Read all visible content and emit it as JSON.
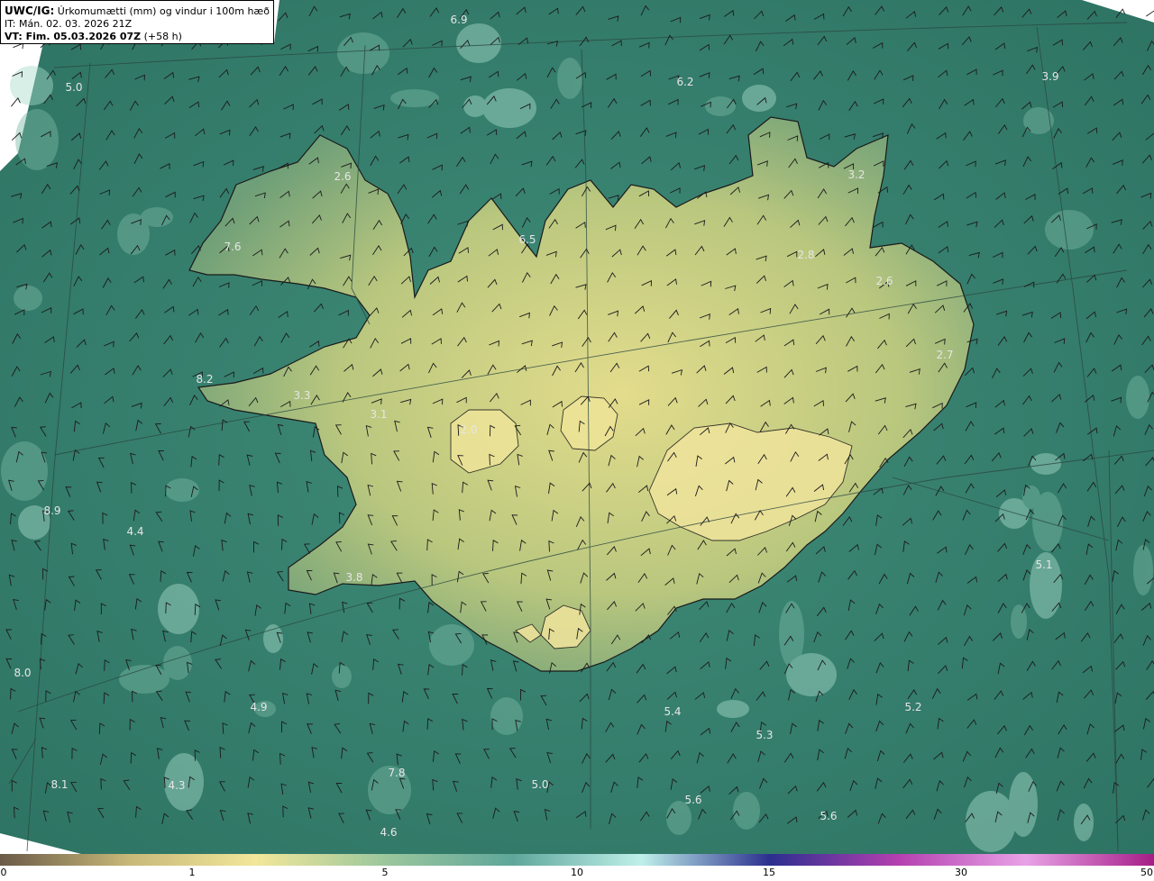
{
  "header": {
    "model": "UWC/IG:",
    "title": "Úrkomumætti (mm) og vindur i 100m hæð",
    "init_time": "IT: Mán. 02. 03. 2026 21Z",
    "valid_label": "VT: Fim. 05.03.2026 07Z",
    "lead": "(+58 h)"
  },
  "colorbar": {
    "ticks": [
      "0",
      "1",
      "5",
      "10",
      "15",
      "30",
      "50"
    ],
    "stops": [
      "#6b5a48",
      "#c7b878",
      "#f2e79a",
      "#9cc79d",
      "#5fa69a",
      "#bff0ea",
      "#2b2f8f",
      "#b43fb0",
      "#e8a2e6",
      "#a51d87"
    ]
  },
  "map_values": [
    {
      "v": "6.9"
    },
    {
      "v": "5.0"
    },
    {
      "v": "6.2"
    },
    {
      "v": "3.9"
    },
    {
      "v": "3.2"
    },
    {
      "v": "2.6"
    },
    {
      "v": "6.5"
    },
    {
      "v": "2.8"
    },
    {
      "v": "7.6"
    },
    {
      "v": "2.6"
    },
    {
      "v": "2.7"
    },
    {
      "v": "8.2"
    },
    {
      "v": "3.3"
    },
    {
      "v": "3.1"
    },
    {
      "v": "2.0"
    },
    {
      "v": "8.9"
    },
    {
      "v": "4.4"
    },
    {
      "v": "3.8"
    },
    {
      "v": "5.1"
    },
    {
      "v": "8.0"
    },
    {
      "v": "4.9"
    },
    {
      "v": "5.4"
    },
    {
      "v": "5.3"
    },
    {
      "v": "5.2"
    },
    {
      "v": "8.1"
    },
    {
      "v": "4.3"
    },
    {
      "v": "7.8"
    },
    {
      "v": "5.0"
    },
    {
      "v": "5.6"
    },
    {
      "v": "5.6"
    },
    {
      "v": "4.6"
    }
  ],
  "colors": {
    "ocean": "#2f7a6a",
    "land_low": "#6fa07a",
    "land_high": "#d9d88a",
    "coast": "#1a1a1a",
    "grid": "#2b4f47"
  }
}
